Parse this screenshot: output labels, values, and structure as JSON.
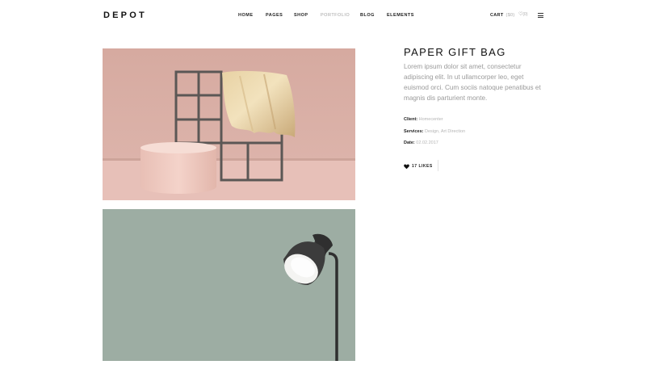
{
  "header": {
    "logo": "DEPOT",
    "nav": [
      {
        "label": "HOME"
      },
      {
        "label": "PAGES"
      },
      {
        "label": "SHOP"
      },
      {
        "label": "PORTFOLIO"
      },
      {
        "label": "BLOG"
      },
      {
        "label": "ELEMENTS"
      }
    ],
    "cart_label": "CART",
    "cart_amount": "($0)",
    "wishlist_count": "(0)"
  },
  "project": {
    "title": "PAPER GIFT BAG",
    "description": "Lorem ipsum dolor sit amet, consectetur adipiscing elit. In ut ullamcorper leo, eget euismod orci. Cum sociis natoque penatibus et magnis dis parturient monte.",
    "client_label": "Client:",
    "client_value": "Homecenter",
    "services_label": "Services:",
    "services_value": "Design, Art Direction",
    "date_label": "Date:",
    "date_value": "02.02.2017",
    "likes": "17 LIKES"
  },
  "colors": {
    "image1_bg": "#dcafa5",
    "image2_bg": "#9dada3",
    "active_nav": "#a0a0a0"
  }
}
